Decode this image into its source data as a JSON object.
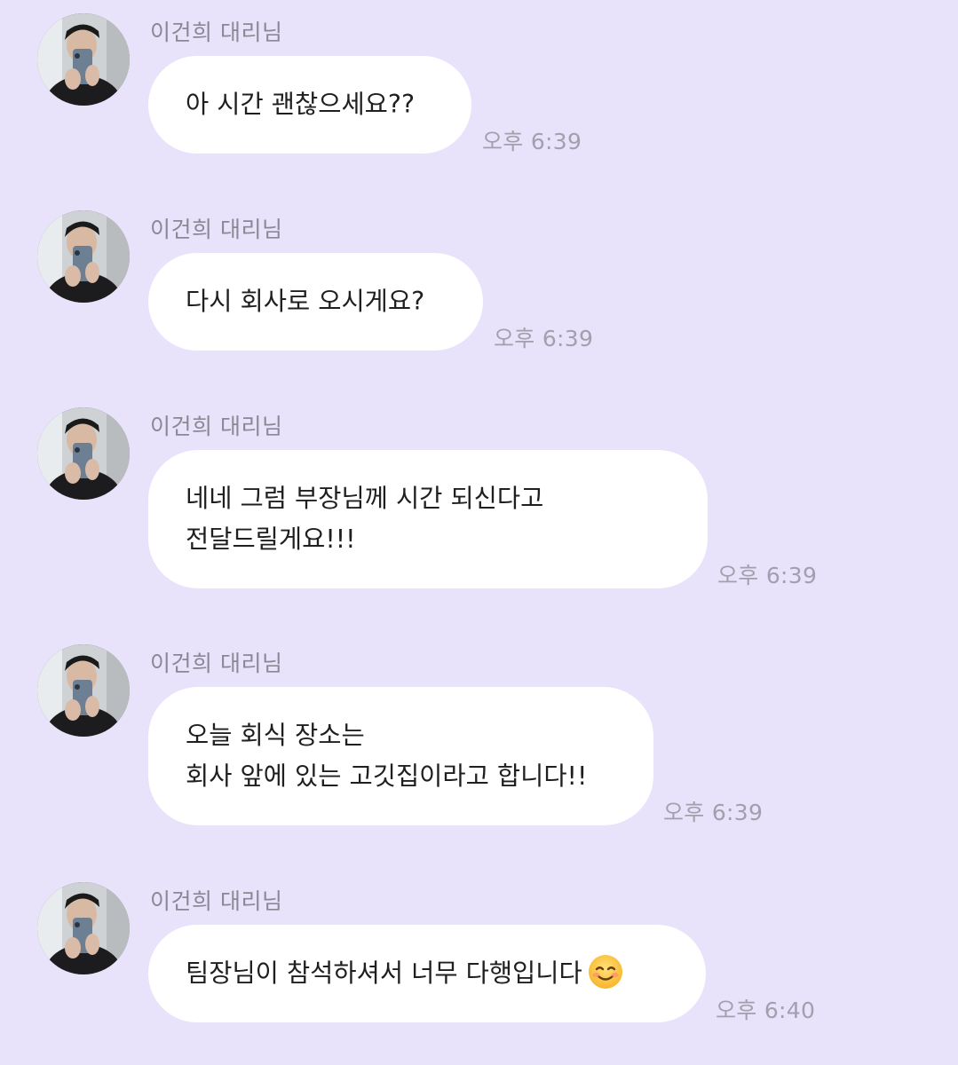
{
  "chat": {
    "messages": [
      {
        "sender": "이건희 대리님",
        "lines": [
          "아 시간 괜찮으세요??"
        ],
        "time": "오후 6:39"
      },
      {
        "sender": "이건희 대리님",
        "lines": [
          "다시 회사로 오시게요?"
        ],
        "time": "오후 6:39"
      },
      {
        "sender": "이건희 대리님",
        "lines": [
          "네네 그럼 부장님께 시간 되신다고",
          "전달드릴게요!!!"
        ],
        "time": "오후 6:39"
      },
      {
        "sender": "이건희 대리님",
        "lines": [
          "오늘 회식 장소는",
          "회사 앞에 있는 고깃집이라고 합니다!!"
        ],
        "time": "오후 6:39"
      },
      {
        "sender": "이건희 대리님",
        "lines": [
          "팀장님이 참석하셔서 너무 다행입니다"
        ],
        "emoji": "smiling-face-emoji",
        "time": "오후 6:40"
      }
    ]
  },
  "colors": {
    "background": "#e8e2fb",
    "bubble": "#ffffff",
    "sender_text": "#8b8894",
    "time_text": "#a3a0ad",
    "message_text": "#1f1f1f"
  }
}
